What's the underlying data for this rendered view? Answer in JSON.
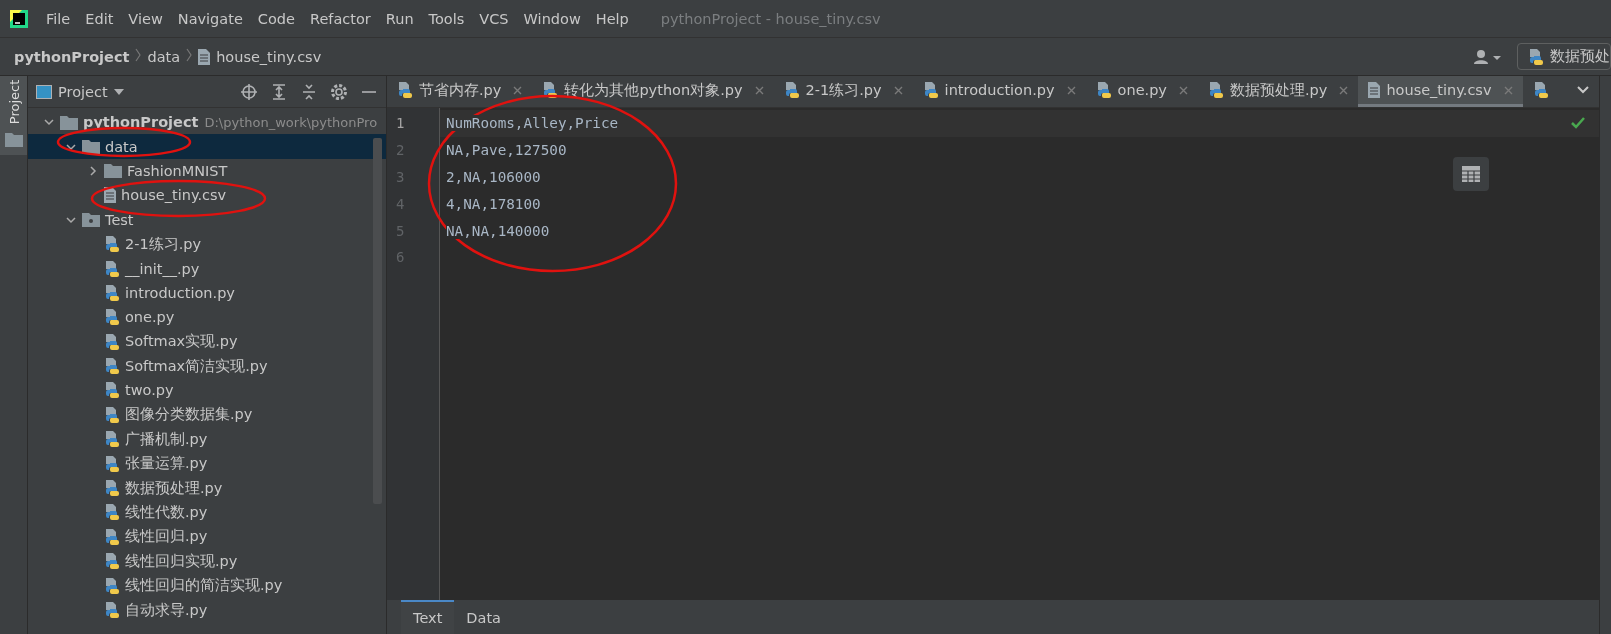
{
  "window": {
    "title": "pythonProject - house_tiny.csv"
  },
  "menu": [
    "File",
    "Edit",
    "View",
    "Navigate",
    "Code",
    "Refactor",
    "Run",
    "Tools",
    "VCS",
    "Window",
    "Help"
  ],
  "breadcrumb": [
    {
      "label": "pythonProject",
      "kind": "project"
    },
    {
      "label": "data",
      "kind": "folder"
    },
    {
      "label": "house_tiny.csv",
      "kind": "file"
    }
  ],
  "run_config": {
    "label": "数据预处"
  },
  "side_strip": {
    "label": "Project"
  },
  "project_panel": {
    "title": "Project",
    "tree": [
      {
        "label": "pythonProject",
        "path": "D:\\python_work\\pythonPro",
        "kind": "folder",
        "expanded": true,
        "selected": false,
        "children": [
          {
            "label": "data",
            "kind": "folder",
            "expanded": true,
            "selected": true,
            "annotated": true,
            "children": [
              {
                "label": "FashionMNIST",
                "kind": "folder",
                "expanded": false,
                "selected": false
              },
              {
                "label": "house_tiny.csv",
                "kind": "text",
                "selected": false,
                "annotated": true
              }
            ]
          },
          {
            "label": "Test",
            "kind": "module",
            "expanded": true,
            "selected": false,
            "children": [
              {
                "label": "2-1练习.py",
                "kind": "python",
                "selected": false
              },
              {
                "label": "__init__.py",
                "kind": "python",
                "selected": false
              },
              {
                "label": "introduction.py",
                "kind": "python",
                "selected": false
              },
              {
                "label": "one.py",
                "kind": "python",
                "selected": false
              },
              {
                "label": "Softmax实现.py",
                "kind": "python",
                "selected": false
              },
              {
                "label": "Softmax简洁实现.py",
                "kind": "python",
                "selected": false
              },
              {
                "label": "two.py",
                "kind": "python",
                "selected": false
              },
              {
                "label": "图像分类数据集.py",
                "kind": "python",
                "selected": false
              },
              {
                "label": "广播机制.py",
                "kind": "python",
                "selected": false
              },
              {
                "label": "张量运算.py",
                "kind": "python",
                "selected": false
              },
              {
                "label": "数据预处理.py",
                "kind": "python",
                "selected": false
              },
              {
                "label": "线性代数.py",
                "kind": "python",
                "selected": false
              },
              {
                "label": "线性回归.py",
                "kind": "python",
                "selected": false
              },
              {
                "label": "线性回归实现.py",
                "kind": "python",
                "selected": false
              },
              {
                "label": "线性回归的简洁实现.py",
                "kind": "python",
                "selected": false
              },
              {
                "label": "自动求导.py",
                "kind": "python",
                "selected": false
              }
            ]
          }
        ]
      }
    ]
  },
  "editor_tabs": [
    {
      "label": "节省内存.py",
      "kind": "python",
      "selected": false
    },
    {
      "label": "转化为其他python对象.py",
      "kind": "python",
      "selected": false
    },
    {
      "label": "2-1练习.py",
      "kind": "python",
      "selected": false
    },
    {
      "label": "introduction.py",
      "kind": "python",
      "selected": false
    },
    {
      "label": "one.py",
      "kind": "python",
      "selected": false
    },
    {
      "label": "数据预处理.py",
      "kind": "python",
      "selected": false
    },
    {
      "label": "house_tiny.csv",
      "kind": "text",
      "selected": true
    }
  ],
  "editor": {
    "lines": [
      {
        "number": "1",
        "text": "NumRooms,Alley,Price",
        "current": true
      },
      {
        "number": "2",
        "text": "NA,Pave,127500",
        "current": false
      },
      {
        "number": "3",
        "text": "2,NA,106000",
        "current": false
      },
      {
        "number": "4",
        "text": "4,NA,178100",
        "current": false
      },
      {
        "number": "5",
        "text": "NA,NA,140000",
        "current": false
      },
      {
        "number": "6",
        "current": false
      }
    ],
    "annotated": true
  },
  "bottom_tabs": [
    {
      "label": "Text",
      "selected": true
    },
    {
      "label": "Data",
      "selected": false
    }
  ]
}
